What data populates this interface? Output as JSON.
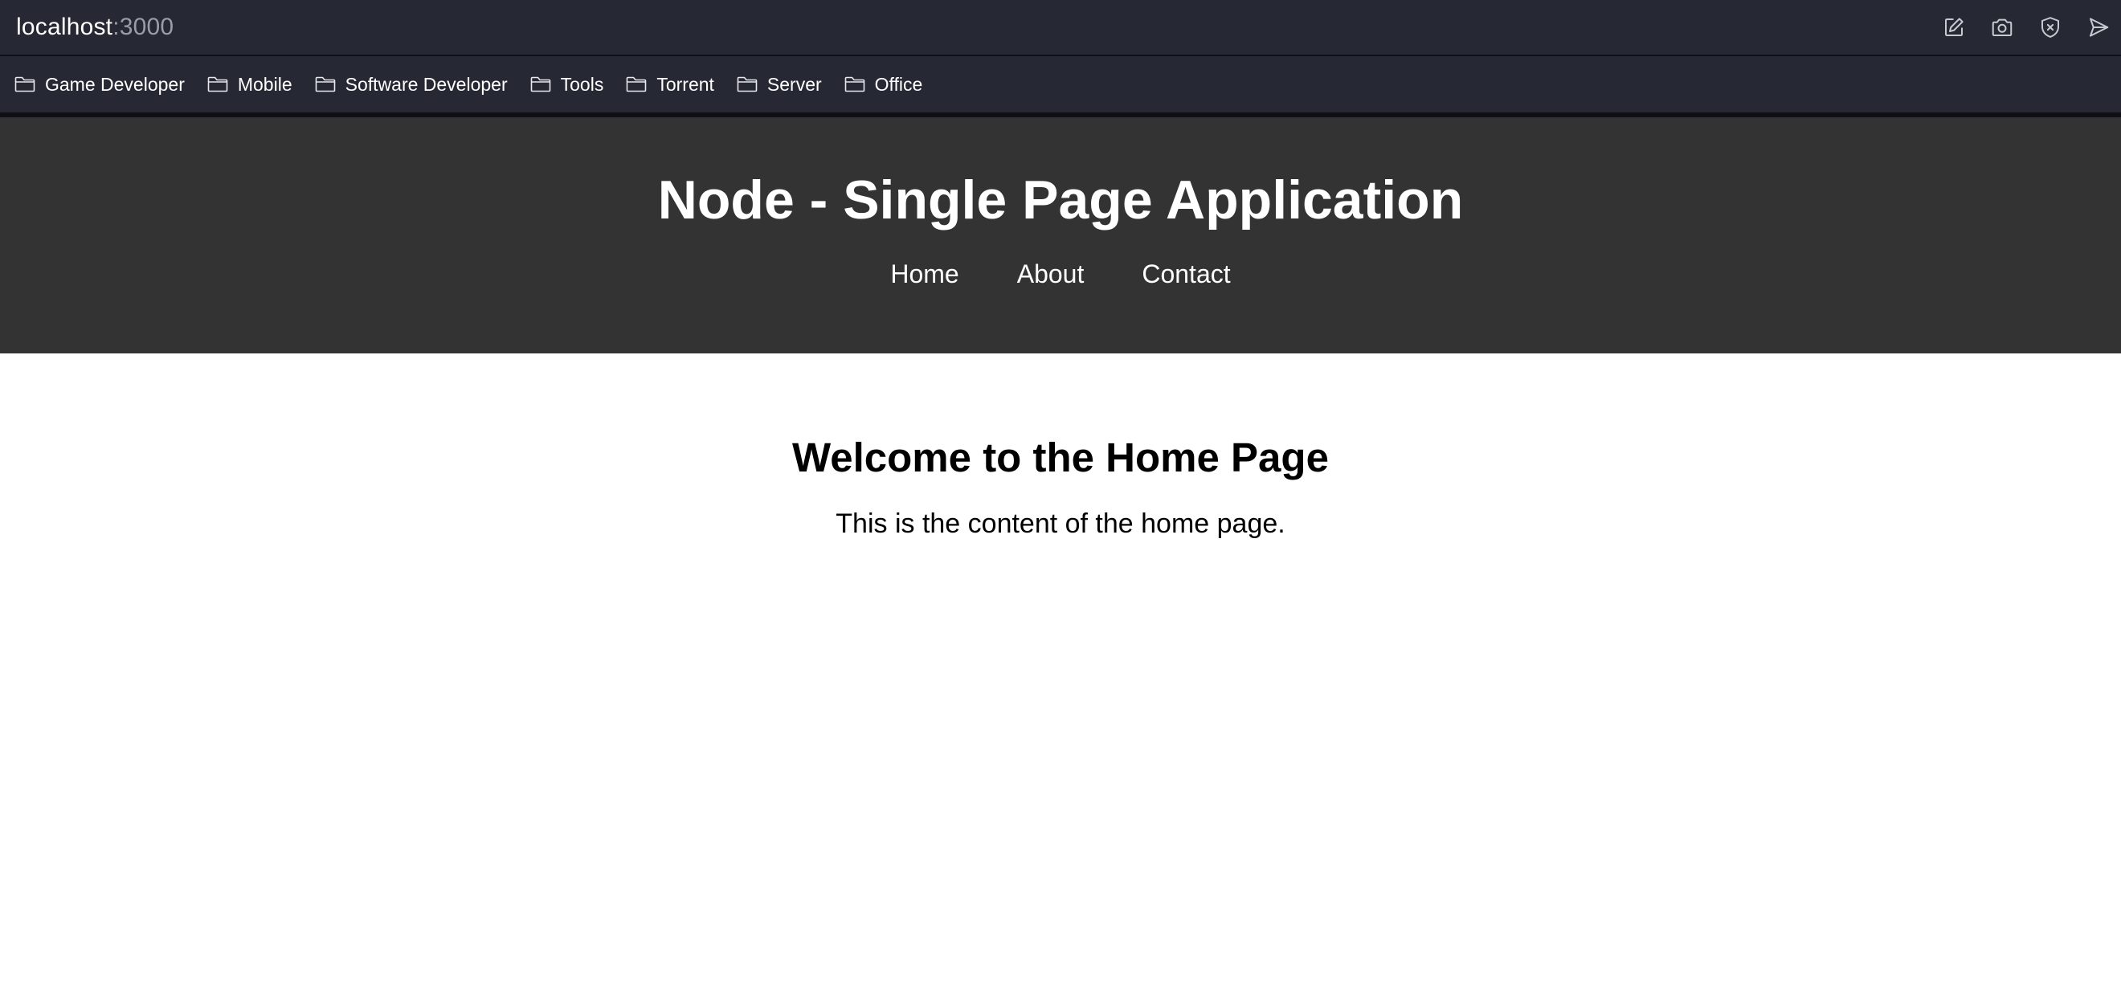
{
  "browser": {
    "url_host": "localhost",
    "url_port": ":3000",
    "icons": [
      "edit-icon",
      "camera-icon",
      "shield-x-icon",
      "send-icon"
    ]
  },
  "bookmarks": [
    {
      "label": "Game Developer"
    },
    {
      "label": "Mobile"
    },
    {
      "label": "Software Developer"
    },
    {
      "label": "Tools"
    },
    {
      "label": "Torrent"
    },
    {
      "label": "Server"
    },
    {
      "label": "Office"
    }
  ],
  "header": {
    "title": "Node - Single Page Application",
    "nav": [
      {
        "label": "Home"
      },
      {
        "label": "About"
      },
      {
        "label": "Contact"
      }
    ]
  },
  "main": {
    "heading": "Welcome to the Home Page",
    "body": "This is the content of the home page."
  },
  "colors": {
    "browser_chrome": "#262833",
    "header_bg": "#333333",
    "page_bg": "#ffffff"
  }
}
